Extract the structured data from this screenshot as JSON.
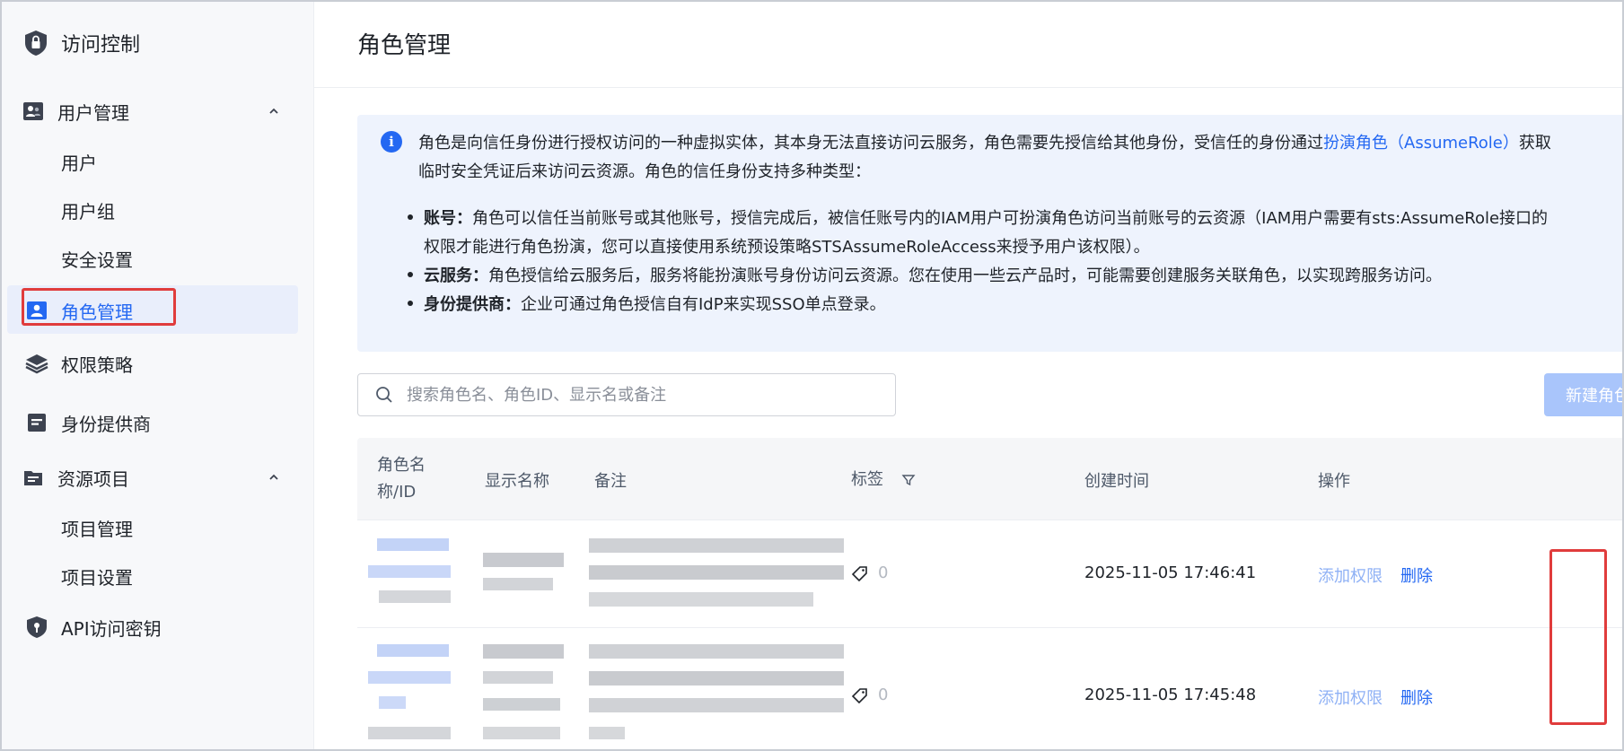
{
  "sidebar": {
    "title": "访问控制",
    "groups": [
      {
        "label": "用户管理",
        "expanded": true,
        "items": [
          "用户",
          "用户组",
          "安全设置"
        ]
      },
      {
        "label": "资源项目",
        "expanded": true,
        "items": [
          "项目管理",
          "项目设置"
        ]
      }
    ],
    "active_item": "角色管理",
    "items": [
      "权限策略",
      "身份提供商",
      "API访问密钥"
    ]
  },
  "page": {
    "title": "角色管理"
  },
  "info": {
    "line1_pre": "角色是向信任身份进行授权访问的一种虚拟实体，其本身无法直接访问云服务，角色需要先授信给其他身份，受信任的身份通过",
    "line1_link": "扮演角色（AssumeRole）",
    "line1_post": "获取",
    "line2": "临时安全凭证后来访问云资源。角色的信任身份支持多种类型：",
    "bullets": [
      {
        "term": "账号：",
        "text": "角色可以信任当前账号或其他账号，授信完成后，被信任账号内的IAM用户可扮演角色访问当前账号的云资源（IAM用户需要有sts:AssumeRole接口的"
      },
      {
        "term": "",
        "text": "权限才能进行角色扮演，您可以直接使用系统预设策略STSAssumeRoleAccess来授予用户该权限）。"
      },
      {
        "term": "云服务：",
        "text": "角色授信给云服务后，服务将能扮演账号身份访问云资源。您在使用一些云产品时，可能需要创建服务关联角色，以实现跨服务访问。"
      },
      {
        "term": "身份提供商：",
        "text": "企业可通过角色授信自有IdP来实现SSO单点登录。"
      }
    ]
  },
  "search": {
    "placeholder": "搜索角色名、角色ID、显示名或备注",
    "value": ""
  },
  "create_button": "新建角色",
  "table": {
    "columns": {
      "name_line1": "角色名",
      "name_line2": "称/ID",
      "display": "显示名称",
      "remark": "备注",
      "tags": "标签",
      "created": "创建时间",
      "actions": "操作"
    },
    "rows": [
      {
        "tag_count": "0",
        "created": "2025-11-05 17:46:41",
        "action_add": "添加权限",
        "action_delete": "删除"
      },
      {
        "tag_count": "0",
        "created": "2025-11-05 17:45:48",
        "action_add": "添加权限",
        "action_delete": "删除"
      }
    ]
  },
  "colors": {
    "accent": "#2468f2",
    "highlight_outline": "#e03c3c",
    "info_bg": "#eef3fd",
    "sidebar_bg": "#f7f8fa"
  }
}
